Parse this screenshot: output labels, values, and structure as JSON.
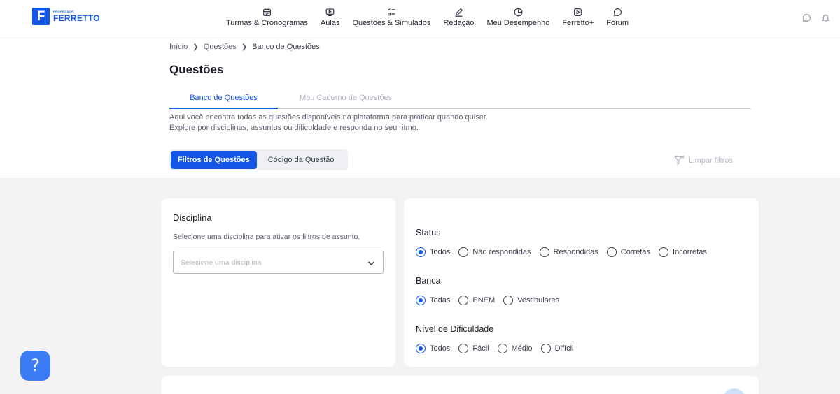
{
  "brand": {
    "small": "PROFESSOR",
    "name": "FERRETTO",
    "mark": "F"
  },
  "nav": [
    {
      "label": "Turmas & Cronogramas",
      "icon": "calendar-icon"
    },
    {
      "label": "Aulas",
      "icon": "video-screen-icon"
    },
    {
      "label": "Questões & Simulados",
      "icon": "checklist-icon"
    },
    {
      "label": "Redação",
      "icon": "pencil-icon"
    },
    {
      "label": "Meu Desempenho",
      "icon": "pie-chart-icon"
    },
    {
      "label": "Ferretto+",
      "icon": "play-icon"
    },
    {
      "label": "Fórum",
      "icon": "chat-bubble-icon"
    }
  ],
  "breadcrumb": [
    "Início",
    "Questões",
    "Banco de Questões"
  ],
  "page_title": "Questões",
  "tabs": {
    "active": "Banco de Questões",
    "inactive": "Meu Caderno de Questões"
  },
  "description": [
    "Aqui você encontra todas as questões disponíveis na plataforma para praticar quando quiser.",
    "Explore por disciplinas, assuntos ou dificuldade e responda no seu ritmo."
  ],
  "filter_toggle": {
    "active": "Filtros de Questões",
    "inactive": "Código da Questão"
  },
  "clear_filters": "Limpar filtros",
  "disciplina": {
    "title": "Disciplina",
    "subtitle": "Selecione uma disciplina para ativar os filtros de assunto.",
    "placeholder": "Selecione uma disciplina"
  },
  "status": {
    "title": "Status",
    "options": [
      "Todos",
      "Não respondidas",
      "Respondidas",
      "Corretas",
      "Incorretas"
    ],
    "selected": "Todos"
  },
  "banca": {
    "title": "Banca",
    "options": [
      "Todas",
      "ENEM",
      "Vestibulares"
    ],
    "selected": "Todas"
  },
  "dificuldade": {
    "title": "Nível de Dificuldade",
    "options": [
      "Todos",
      "Fácil",
      "Médio",
      "Difícil"
    ],
    "selected": "Todos"
  },
  "help": "?",
  "colors": {
    "primary": "#1456e6",
    "background_gray": "#f3f3f5"
  }
}
